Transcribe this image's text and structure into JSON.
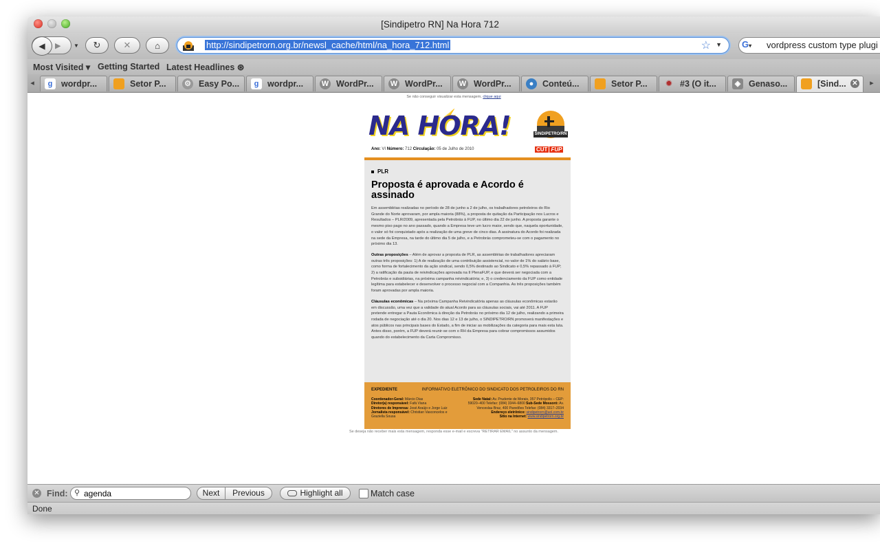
{
  "window": {
    "title": "[Sindipetro RN] Na Hora 712"
  },
  "navigation": {
    "url": "http://sindipetrorn.org.br/newsl_cache/html/na_hora_712.html",
    "search_value": "vordpress custom type plugi",
    "search_engine_icon": "google-icon"
  },
  "bookmarks": [
    {
      "label": "Most Visited ▾"
    },
    {
      "label": "Getting Started"
    },
    {
      "label": "Latest Headlines ⊛"
    }
  ],
  "tabs": [
    {
      "label": "wordpr...",
      "icon": "google-icon"
    },
    {
      "label": "Setor P...",
      "icon": "sindipetro-icon"
    },
    {
      "label": "Easy Po...",
      "icon": "gear-icon"
    },
    {
      "label": "wordpr...",
      "icon": "google-icon"
    },
    {
      "label": "WordPr...",
      "icon": "wordpress-icon"
    },
    {
      "label": "WordPr...",
      "icon": "wordpress-icon"
    },
    {
      "label": "WordPr...",
      "icon": "wordpress-icon"
    },
    {
      "label": "Conteú...",
      "icon": "drupal-icon"
    },
    {
      "label": "Setor P...",
      "icon": "sindipetro-icon"
    },
    {
      "label": "#3 (O it...",
      "icon": "bug-icon"
    },
    {
      "label": "Genaso...",
      "icon": "page-icon"
    },
    {
      "label": "[Sind...",
      "icon": "sindipetro-icon",
      "active": true
    }
  ],
  "newsletter": {
    "top_notice": "Se não conseguir visualizar esta mensagem,",
    "top_link": "clique aqui",
    "logo_text": "NA HORA!",
    "sindi_label": "SINDIPETRO/RN",
    "cut_label": "CUT",
    "fup_label": "FUP",
    "issue_ano_label": "Ano:",
    "issue_ano": "VI",
    "issue_numero_label": "Número:",
    "issue_numero": "712",
    "issue_circulacao_label": "Circulação:",
    "issue_circulacao": "05 de Julho de 2010",
    "section": "PLR",
    "headline": "Proposta é aprovada e Acordo é assinado",
    "paragraph1": "Em assembléias realizadas no período de 28 de junho a 2 de julho, os trabalhadores petroleiros do Rio Grande do Norte aprovaram, por ampla maioria (88%), a proposta de quitação da Participação nos Lucros e Resultados – PLR/2009, apresentada pela Petrobrás à FUP, no último dia 22 de junho. A proposta garante o mesmo piso pago no ano passado, quando a Empresa teve um lucro maior, sendo que, naquela oportunidade, o valor só foi conquistado após a realização de uma greve de cinco dias. A assinatura do Acordo foi realizada na sede da Empresa, na tarde do último dia 5 de julho, e a Petrobrás comprometeu-se com o pagamento no próximo dia 13.",
    "paragraph2_title": "Outras proposições",
    "paragraph2": " – Além de aprovar a proposta de PLR, as assembléias de trabalhadores apreciaram outras três proposições: 1) A de realização de uma contribuição assistencial, no valor de 1% do salário base, como forma de fortalecimento da ação sindical, sendo 0,5% destinado ao Sindicato e 0,5% repassado à FUP; 2) a ratificação da pauta de reivindicações aprovada na II PlenaFUP, e que deverá ser negociada com a Petrobrás e subsidiárias, na próxima campanha reivindicatória; e, 3) o credenciamento da FUP como entidade legítima para estabelecer e desenvolver o processo negocial com a Companhia. As três proposições também foram aprovadas por ampla maioria.",
    "paragraph3_title": "Cláusulas econômicas",
    "paragraph3": " – Na próxima Campanha Reivindicatória apenas as cláusulas econômicas estarão em discussão, uma vez que a validade do atual Acordo para as cláusulas sociais, vai até 2011. A FUP pretende entregar a Pauta Econômica à direção da Petrobrás no próximo dia 12 de julho, realizando a primeira rodada de negociação até o dia 20. Nos dias 12 e 13 de julho, o SINDIPETRO/RN promoverá manifestações e atos públicos nas principais bases do Estado, a fim de iniciar as mobilizações da categoria para mais esta luta. Antes disso, porém, a FUP deverá reunir-se com o RH da Empresa para cobrar compromissos assumidos quando do estabelecimento da Carta Compromisso.",
    "footer_title": "EXPEDIENTE",
    "footer_subtitle": "INFORMATIVO ELETRÔNICO DO SINDICATO DOS PETROLEIROS DO RN",
    "footer_left": [
      {
        "label": "Coordenador-Geral:",
        "value": " Márcio Dias"
      },
      {
        "label": "Diretor(a) responsável:",
        "value": " Fafá Viana"
      },
      {
        "label": "Diretores de Imprensa:",
        "value": " José Araújo e Jorge Luiz"
      },
      {
        "label": "Jornalista responsável:",
        "value": " Christian Vasconcelos e Graziella Sousa"
      }
    ],
    "footer_right_1_label": "Sede Natal:",
    "footer_right_1": " Av. Prudente de Morais, 357 Petrópolis – CEP: 59020–400 Telefax: (084) 3344–6800",
    "footer_right_2_label": "Sub-Sede Mossoró:",
    "footer_right_2": " Av. Venceslau Braz, 400 Paredões Telefax: (084) 3317–2034",
    "footer_email_label": "Endereço eletrônico:",
    "footer_email": "sindipetrorn@uol.com.br",
    "footer_site_label": "Sítio na Internet:",
    "footer_site": "www.sindipetrorn.org.br",
    "bottom_notice": "Se deseja não receber mais esta mensagem, responda esse e-mail e escreva \"RETIRAR EMAIL\" no assunto da mensagem."
  },
  "findbar": {
    "label": "Find:",
    "value": "agenda",
    "next_label": "Next",
    "previous_label": "Previous",
    "highlight_label": "Highlight all",
    "match_case_label": "Match case"
  },
  "status": {
    "text": "Done"
  }
}
